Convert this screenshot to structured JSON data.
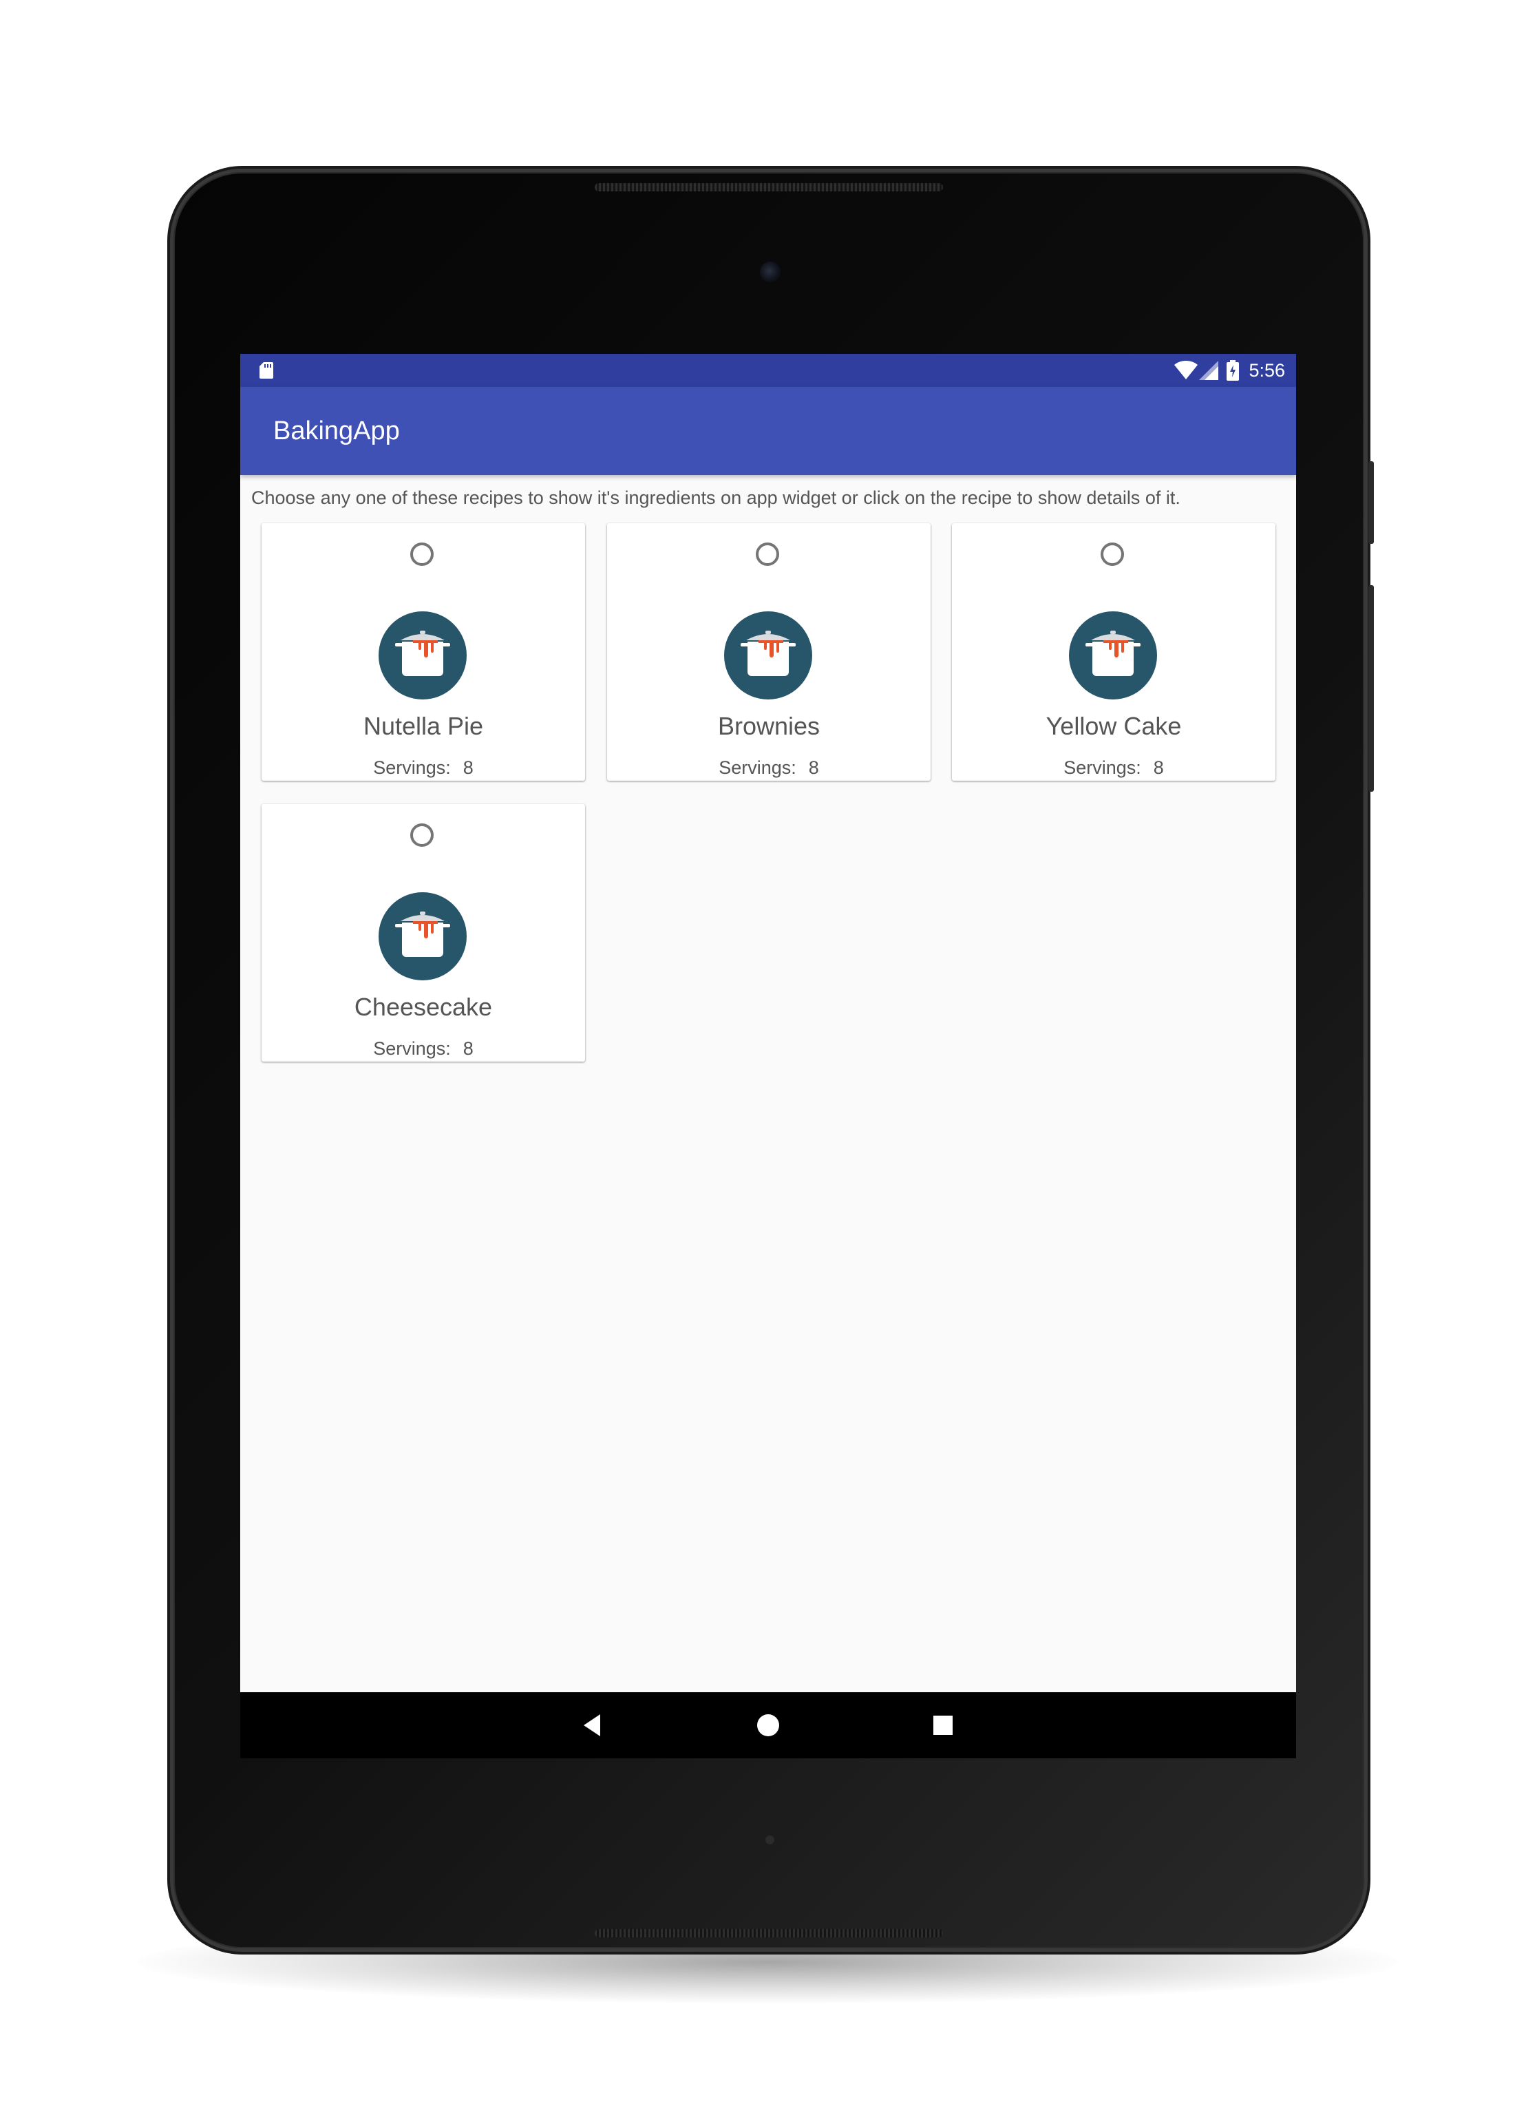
{
  "status_bar": {
    "time": "5:56",
    "icons": [
      "sd-card-icon",
      "wifi-icon",
      "cell-signal-icon",
      "battery-charging-icon"
    ],
    "color": "#303f9f"
  },
  "app_bar": {
    "title": "BakingApp",
    "color": "#3f51b5"
  },
  "instruction": "Choose any one of these recipes to show it's ingredients on app widget or click on the recipe to show details of it.",
  "recipes": [
    {
      "name": "Nutella Pie",
      "servings_label": "Servings:",
      "servings": "8",
      "selected": false
    },
    {
      "name": "Brownies",
      "servings_label": "Servings:",
      "servings": "8",
      "selected": false
    },
    {
      "name": "Yellow Cake",
      "servings_label": "Servings:",
      "servings": "8",
      "selected": false
    },
    {
      "name": "Cheesecake",
      "servings_label": "Servings:",
      "servings": "8",
      "selected": false
    }
  ],
  "recipe_icon": {
    "name": "cooking-pot-icon",
    "circle_color": "#27566b",
    "accent_color": "#e8542a"
  },
  "nav_bar": {
    "icons": [
      "back-icon",
      "home-icon",
      "recents-icon"
    ]
  }
}
